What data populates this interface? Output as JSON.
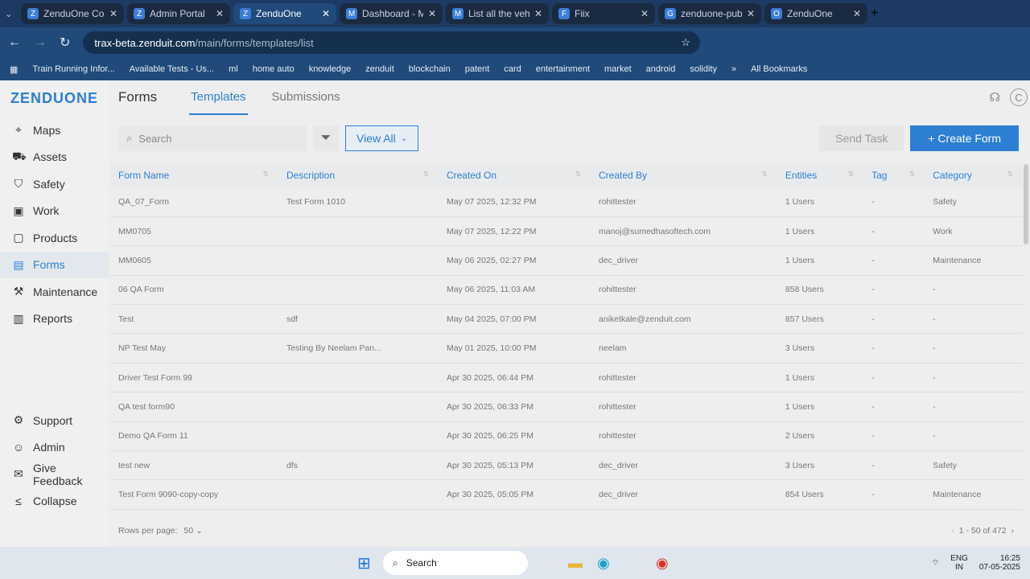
{
  "browser": {
    "tabs": [
      {
        "label": "ZenduOne Cons",
        "icon": "Z",
        "active": false
      },
      {
        "label": "Admin Portal",
        "icon": "Z",
        "active": false
      },
      {
        "label": "ZenduOne",
        "icon": "Z",
        "active": true
      },
      {
        "label": "Dashboard - Mo",
        "icon": "M",
        "active": false
      },
      {
        "label": "List all the vehicl",
        "icon": "M",
        "active": false
      },
      {
        "label": "Fiix",
        "icon": "F",
        "active": false
      },
      {
        "label": "zenduone-publi",
        "icon": "G",
        "active": false
      },
      {
        "label": "ZenduOne",
        "icon": "O",
        "active": false
      }
    ],
    "url_host": "trax-beta.zenduit.com",
    "url_path": "/main/forms/templates/list",
    "bookmarks": [
      "Train Running Infor...",
      "Available Tests - Us...",
      "ml",
      "home auto",
      "knowledge",
      "zenduit",
      "blockchain",
      "patent",
      "card",
      "entertainment",
      "market",
      "android",
      "solidity"
    ],
    "all_bookmarks": "All Bookmarks"
  },
  "app": {
    "logo": "ZENDUONE",
    "nav": [
      {
        "label": "Maps",
        "icon": "map-pin-icon",
        "glyph": "⌖"
      },
      {
        "label": "Assets",
        "icon": "truck-icon",
        "glyph": "⛟"
      },
      {
        "label": "Safety",
        "icon": "shield-icon",
        "glyph": "⛉"
      },
      {
        "label": "Work",
        "icon": "briefcase-icon",
        "glyph": "▣"
      },
      {
        "label": "Products",
        "icon": "box-icon",
        "glyph": "▢"
      },
      {
        "label": "Forms",
        "icon": "form-icon",
        "glyph": "▤",
        "active": true
      },
      {
        "label": "Maintenance",
        "icon": "wrench-icon",
        "glyph": "⚒"
      },
      {
        "label": "Reports",
        "icon": "report-icon",
        "glyph": "▥"
      }
    ],
    "nav_bottom": [
      {
        "label": "Support",
        "icon": "support-icon",
        "glyph": "⚙"
      },
      {
        "label": "Admin",
        "icon": "user-icon",
        "glyph": "☺"
      },
      {
        "label": "Give Feedback",
        "icon": "feedback-icon",
        "glyph": "✉"
      },
      {
        "label": "Collapse",
        "icon": "collapse-icon",
        "glyph": "≤"
      }
    ],
    "page_title": "Forms",
    "tabs": [
      "Templates",
      "Submissions"
    ],
    "avatar": "C",
    "search_placeholder": "Search",
    "view_all": "View All",
    "send_task": "Send Task",
    "create_form": "+ Create Form",
    "columns": [
      "Form Name",
      "Description",
      "Created On",
      "Created By",
      "Entities",
      "Tag",
      "Category"
    ],
    "rows": [
      [
        "QA_07_Form",
        "Test Form 1010",
        "May 07 2025, 12:32 PM",
        "rohittester",
        "1 Users",
        "-",
        "Safety"
      ],
      [
        "MM0705",
        "",
        "May 07 2025, 12:22 PM",
        "manoj@sumedhasoftech.com",
        "1 Users",
        "-",
        "Work"
      ],
      [
        "MM0605",
        "",
        "May 06 2025, 02:27 PM",
        "dec_driver",
        "1 Users",
        "-",
        "Maintenance"
      ],
      [
        "06 QA Form",
        "",
        "May 06 2025, 11:03 AM",
        "rohittester",
        "858 Users",
        "-",
        "-"
      ],
      [
        "Test",
        "sdf",
        "May 04 2025, 07:00 PM",
        "aniketkale@zenduit.com",
        "857 Users",
        "-",
        "-"
      ],
      [
        "NP Test May",
        "Testing By Neelam Pan...",
        "May 01 2025, 10:00 PM",
        "neelam",
        "3 Users",
        "-",
        "-"
      ],
      [
        "Driver Test Form 99",
        "",
        "Apr 30 2025, 06:44 PM",
        "rohittester",
        "1 Users",
        "-",
        "-"
      ],
      [
        "QA test form90",
        "",
        "Apr 30 2025, 06:33 PM",
        "rohittester",
        "1 Users",
        "-",
        "-"
      ],
      [
        "Demo QA Form 11",
        "",
        "Apr 30 2025, 06:25 PM",
        "rohittester",
        "2 Users",
        "-",
        "-"
      ],
      [
        "test new",
        "dfs",
        "Apr 30 2025, 05:13 PM",
        "dec_driver",
        "3 Users",
        "-",
        "Safety"
      ],
      [
        "Test Form 9090-copy-copy",
        "",
        "Apr 30 2025, 05:05 PM",
        "dec_driver",
        "854 Users",
        "-",
        "Maintenance"
      ]
    ],
    "rows_per_page_label": "Rows per page:",
    "rows_per_page": "50",
    "pagination": "1 - 50 of 472"
  },
  "taskbar": {
    "search": "Search",
    "lang": "ENG",
    "region": "IN",
    "time": "16:25",
    "date": "07-05-2025"
  }
}
